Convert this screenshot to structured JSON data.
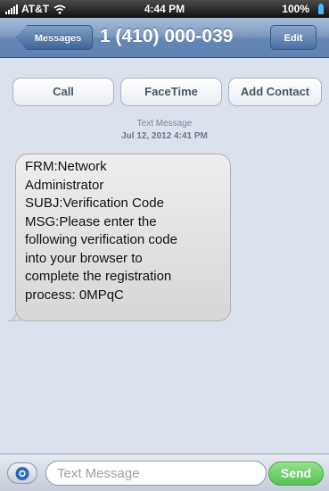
{
  "status_bar": {
    "carrier": "AT&T",
    "time": "4:44 PM",
    "battery": "100%"
  },
  "nav": {
    "back_label": "Messages",
    "title": "1 (410) 000-039",
    "edit_label": "Edit",
    "accent": "#6487b5"
  },
  "actions": {
    "call": "Call",
    "facetime": "FaceTime",
    "add_contact": "Add Contact"
  },
  "meta": {
    "type": "Text Message",
    "date": "Jul 12, 2012 4:41 PM"
  },
  "message": {
    "lines": [
      "FRM:Network",
      "Administrator",
      "SUBJ:Verification Code",
      "MSG:Please enter the",
      "following verification code",
      "into your browser to",
      "complete the registration",
      "process: 0MPqC"
    ]
  },
  "composer": {
    "placeholder": "Text Message",
    "value": "",
    "send_label": "Send",
    "send_color": "#3ec33a"
  },
  "icons": {
    "wifi": "wifi-icon",
    "signal": "signal-icon",
    "battery": "battery-icon",
    "camera": "camera-icon"
  }
}
